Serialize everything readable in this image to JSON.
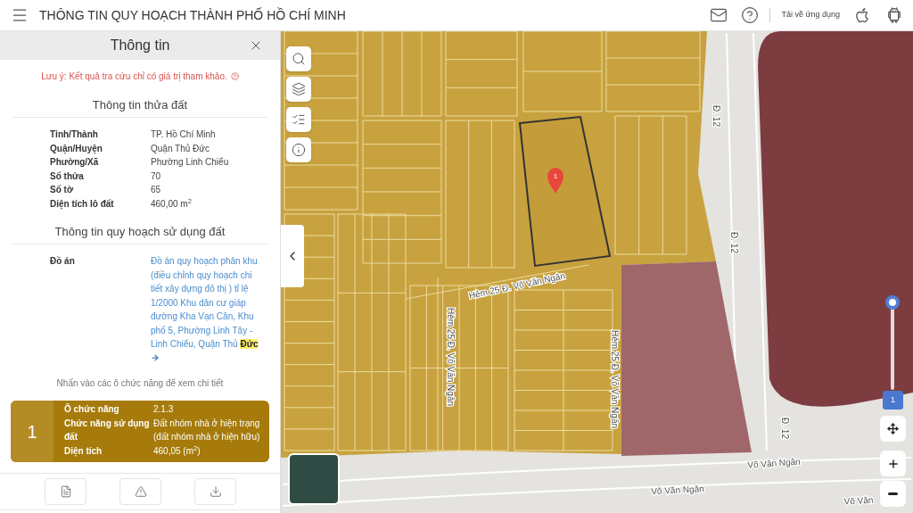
{
  "header": {
    "title": "THÔNG TIN QUY HOẠCH THÀNH PHỐ HỒ CHÍ MINH",
    "download_label": "Tải về ứng dụng"
  },
  "panel": {
    "title": "Thông tin",
    "notice": "Lưu ý: Kết quả tra cứu chỉ có giá trị tham khảo.",
    "parcel_section": {
      "heading": "Thông tin thửa đất",
      "rows": [
        {
          "label": "Tỉnh/Thành",
          "value": "TP. Hồ Chí Minh"
        },
        {
          "label": "Quận/Huyện",
          "value": "Quận Thủ Đức"
        },
        {
          "label": "Phường/Xã",
          "value": "Phường Linh Chiểu"
        },
        {
          "label": "Số thửa",
          "value": "70"
        },
        {
          "label": "Số tờ",
          "value": "65"
        },
        {
          "label": "Diện tích lô đất",
          "value": "460,00 m$^{2}$"
        }
      ]
    },
    "planning_section": {
      "heading": "Thông tin quy hoạch sử dụng đất",
      "project": {
        "label": "Đồ án",
        "text": "Đồ án quy hoạch phân khu (điều chỉnh quy hoạch chi tiết xây dựng đô thị ) tỉ lệ 1/2000 Khu dân cư giáp đường Kha Vạn Cân, Khu phố 5, Phường Linh Tây - Linh Chiểu, Quận Thủ",
        "highlight": "Đức"
      },
      "hint": "Nhấn vào các ô chức năng để xem chi tiết"
    },
    "function_cells": [
      {
        "number": "1",
        "color": "#a67b0b",
        "rows": [
          {
            "label": "Ô chức năng",
            "value": "2.1.3"
          },
          {
            "label": "Chức năng sử dụng đất",
            "value": "Đất nhóm nhà ở hiện trạng (đất nhóm nhà ở hiện hữu)"
          },
          {
            "label": "Diện tích",
            "value": "460,05 (m$^{2}$)"
          }
        ]
      }
    ]
  },
  "map": {
    "parcel_marker": "1",
    "road_labels": [
      "Đ. 12",
      "Đ. 12",
      "Đ. 12",
      "Võ Văn Ngân",
      "Võ Văn Ngân",
      "Hẻm 25 Đ. Võ Văn Ngân",
      "Hẻm 25 Đ. Võ Văn Ngân",
      "Hẻm 25 Đ. Võ Văn Ngân",
      "Võ Văn"
    ],
    "layer_slider": {
      "level": 1,
      "reading": "1"
    }
  }
}
